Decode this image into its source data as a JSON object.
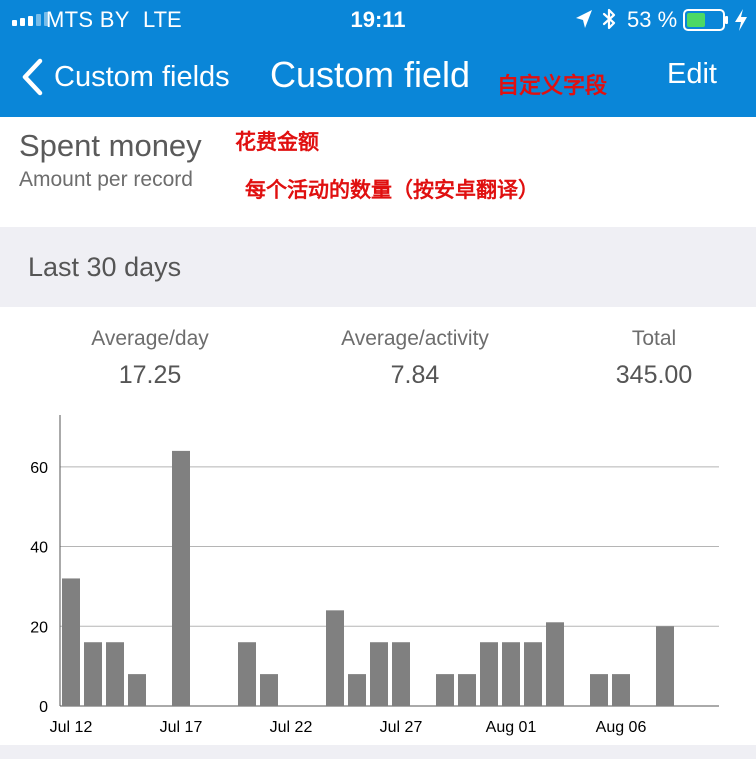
{
  "status_bar": {
    "carrier": "MTS BY",
    "network": "LTE",
    "time": "19:11",
    "battery": "53 %",
    "battery_level": 0.53,
    "icons": [
      "signal-icon",
      "location-arrow-icon",
      "bluetooth-icon",
      "battery-icon",
      "charging-bolt-icon"
    ]
  },
  "nav": {
    "back_label": "Custom fields",
    "title": "Custom field",
    "title_note": "自定义字段",
    "edit_label": "Edit"
  },
  "field": {
    "name": "Spent money",
    "name_note": "花费金额",
    "description": "Amount per record",
    "description_note": "每个活动的数量（按安卓翻译）"
  },
  "section": {
    "title": "Last 30 days"
  },
  "stats": [
    {
      "label": "Average/day",
      "value": "17.25"
    },
    {
      "label": "Average/activity",
      "value": "7.84"
    },
    {
      "label": "Total",
      "value": "345.00"
    }
  ],
  "colors": {
    "accent": "#0a86d8",
    "bar": "#808080",
    "note": "#e01010",
    "section_bg": "#efeff4"
  },
  "chart_data": {
    "type": "bar",
    "categories": [
      "Jul 12",
      "Jul 13",
      "Jul 14",
      "Jul 15",
      "Jul 16",
      "Jul 17",
      "Jul 18",
      "Jul 19",
      "Jul 20",
      "Jul 21",
      "Jul 22",
      "Jul 23",
      "Jul 24",
      "Jul 25",
      "Jul 26",
      "Jul 27",
      "Jul 28",
      "Jul 29",
      "Jul 30",
      "Jul 31",
      "Aug 01",
      "Aug 02",
      "Aug 03",
      "Aug 04",
      "Aug 05",
      "Aug 06",
      "Aug 07",
      "Aug 08",
      "Aug 09",
      "Aug 10"
    ],
    "values": [
      32,
      16,
      16,
      8,
      0,
      64,
      0,
      0,
      16,
      8,
      0,
      0,
      24,
      8,
      16,
      16,
      0,
      8,
      8,
      16,
      16,
      16,
      21,
      0,
      8,
      8,
      0,
      20,
      0,
      0
    ],
    "x_tick_labels": [
      "Jul 12",
      "Jul 17",
      "Jul 22",
      "Jul 27",
      "Aug 01",
      "Aug 06"
    ],
    "y_ticks": [
      0,
      20,
      40,
      60
    ],
    "ylim": [
      0,
      73
    ],
    "grid": true
  }
}
